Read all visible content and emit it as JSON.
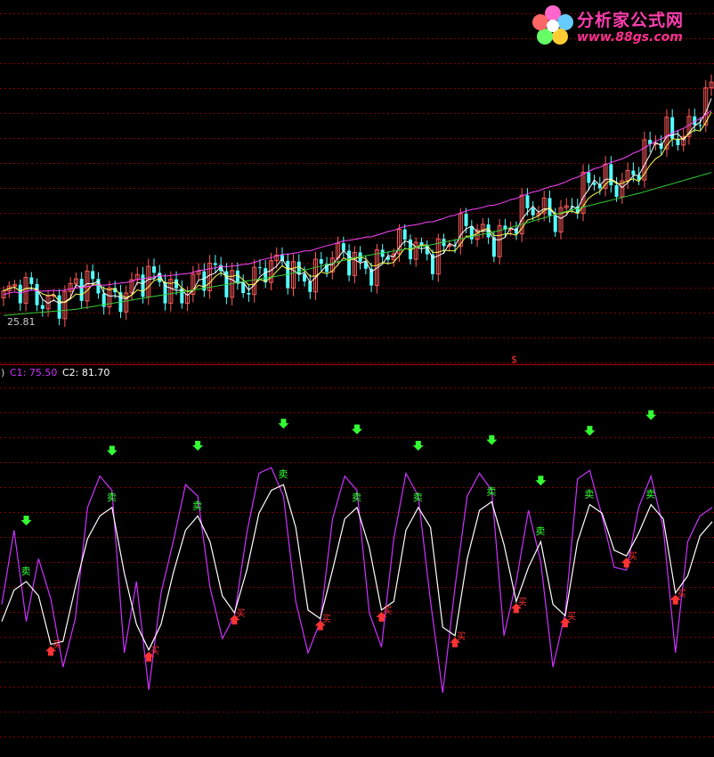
{
  "logo": {
    "name": "分析家公式网",
    "url": "www.88gs.com"
  },
  "price_panel": {
    "low_label": "25.81"
  },
  "indicator_panel": {
    "prefix": ")",
    "c1": "C1: 75.50",
    "c2": "C2: 81.70",
    "buy_text": "买",
    "sell_text": "卖",
    "marker_text": "$"
  },
  "colors": {
    "up": "#ff5a5a",
    "down": "#54ffff",
    "ma_short": "#ffffff",
    "ma_mid": "#ffff55",
    "ma_long": "#ff44ff",
    "ma_longest": "#33cc33",
    "c1": "#cc33ff",
    "c2": "#ffffff",
    "grid": "#800000",
    "buy": "#ff3333",
    "sell": "#33ff33"
  },
  "chart_data": [
    {
      "type": "candlestick",
      "ylim": [
        25.81,
        30.85
      ],
      "ma_short_tail": [
        29.4,
        29.7,
        29.95,
        30.1,
        30.3
      ],
      "ma_mid_tail": [
        29.3,
        29.5,
        29.7,
        29.85,
        30.0
      ],
      "ma_long": [
        26.2,
        26.4,
        26.6,
        26.8,
        27.0,
        27.3,
        27.6,
        27.9,
        28.2,
        28.5,
        28.9,
        29.3,
        29.7
      ],
      "ma_longest": [
        25.9,
        26.0,
        26.2,
        26.4,
        26.6,
        26.9,
        27.1,
        27.35,
        27.7,
        28.0,
        28.35
      ]
    },
    {
      "type": "line",
      "series": [
        {
          "name": "C1",
          "last": 75.5
        },
        {
          "name": "C2",
          "last": 81.7
        }
      ],
      "c1": [
        52,
        78,
        46,
        68,
        54,
        30,
        47,
        86,
        97,
        92,
        35,
        60,
        22,
        56,
        74,
        94,
        90,
        58,
        40,
        48,
        77,
        98,
        100,
        90,
        53,
        35,
        46,
        82,
        97,
        92,
        49,
        37,
        75,
        98,
        90,
        53,
        21,
        58,
        90,
        98,
        92,
        41,
        60,
        85,
        67,
        30,
        49,
        96,
        99,
        83,
        65,
        64,
        86,
        97,
        79,
        35,
        74,
        83,
        86
      ],
      "c2": [
        46,
        57,
        60,
        55,
        38,
        39,
        58,
        75,
        83,
        86,
        63,
        45,
        36,
        45,
        63,
        78,
        83,
        74,
        55,
        49,
        64,
        84,
        92,
        94,
        79,
        50,
        47,
        64,
        82,
        86,
        72,
        50,
        53,
        78,
        86,
        79,
        44,
        41,
        68,
        85,
        88,
        73,
        53,
        65,
        74,
        52,
        48,
        74,
        87,
        84,
        71,
        69,
        77,
        87,
        82,
        56,
        62,
        76,
        81
      ]
    }
  ]
}
